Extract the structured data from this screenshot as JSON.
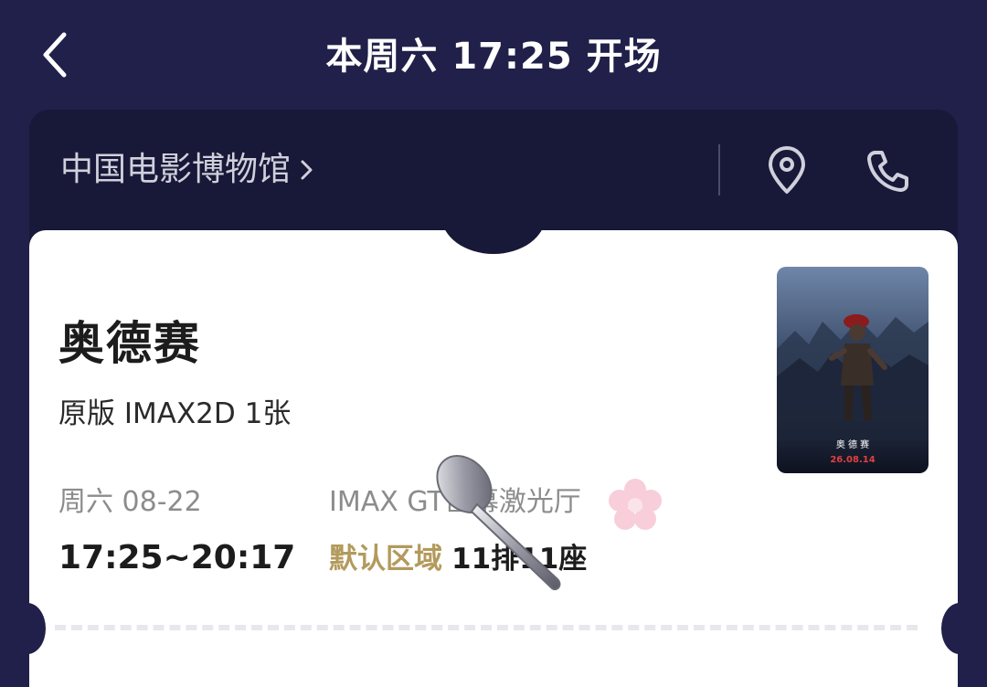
{
  "header": {
    "title": "本周六 17:25 开场"
  },
  "cinema": {
    "name": "中国电影博物馆",
    "location_icon": "location-pin-icon",
    "phone_icon": "phone-icon"
  },
  "ticket": {
    "movie_title": "奥德赛",
    "format": "原版 IMAX2D 1张",
    "date": "周六 08-22",
    "time": "17:25~20:17",
    "hall": "IMAX GT巨幕激光厅",
    "seat_area": "默认区域",
    "seat": "11排11座",
    "poster": {
      "title_text": "奥 德 赛",
      "date_text": "26.08.14"
    }
  },
  "colors": {
    "background": "#20204a",
    "cinema_bar": "#181838",
    "seat_area": "#b39a5c"
  }
}
